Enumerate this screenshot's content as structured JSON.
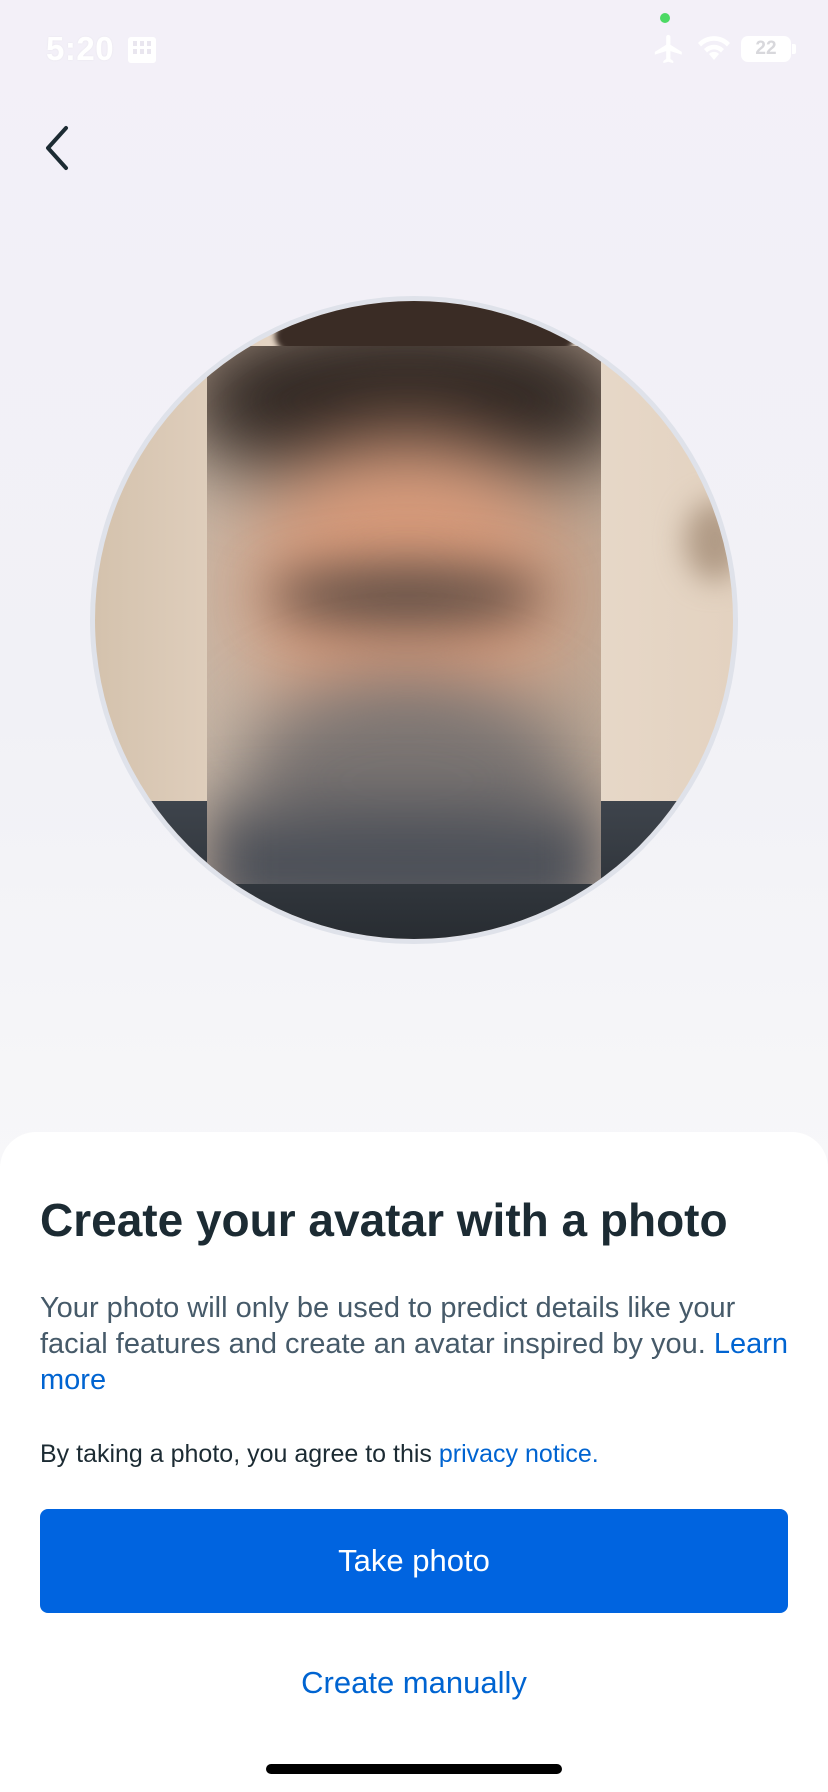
{
  "status_bar": {
    "time": "5:20",
    "battery": "22"
  },
  "icons": {
    "back": "chevron-left-icon",
    "sim": "sim-card-icon",
    "airplane": "airplane-icon",
    "wifi": "wifi-icon",
    "battery": "battery-icon"
  },
  "sheet": {
    "title": "Create your avatar with a photo",
    "description": "Your photo will only be used to predict details like your facial features and create an avatar inspired by you.",
    "learn_more": "Learn more",
    "agreement_text": "By taking a photo, you agree to this",
    "privacy_link": "privacy notice.",
    "take_photo_label": "Take photo",
    "create_manually_label": "Create manually"
  },
  "colors": {
    "primary": "#0064e0",
    "link": "#0064d1",
    "title": "#1c2b33",
    "body_text": "#465a69"
  }
}
